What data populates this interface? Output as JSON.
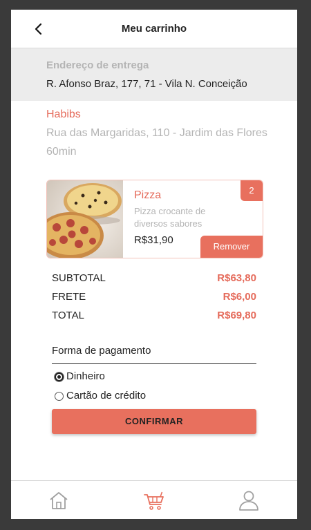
{
  "header": {
    "title": "Meu carrinho",
    "back_icon": "chevron-left-icon"
  },
  "delivery": {
    "label": "Endereço de entrega",
    "address": "R. Afonso Braz, 177, 71 - Vila N. Conceição"
  },
  "restaurant": {
    "name": "Habibs",
    "address": "Rua das Margaridas, 110 - Jardim das Flores",
    "time": "60min"
  },
  "cart_items": [
    {
      "name": "Pizza",
      "description": "Pizza crocante de diversos sabores",
      "price": "R$31,90",
      "quantity": "2",
      "remove_label": "Remover"
    }
  ],
  "totals": {
    "subtotal_label": "SUBTOTAL",
    "subtotal_value": "R$63,80",
    "frete_label": "FRETE",
    "frete_value": "R$6,00",
    "total_label": "TOTAL",
    "total_value": "R$69,80"
  },
  "payment": {
    "title": "Forma de pagamento",
    "options": [
      {
        "label": "Dinheiro",
        "selected": true
      },
      {
        "label": "Cartão de crédito",
        "selected": false
      }
    ],
    "confirm_label": "CONFIRMAR"
  },
  "bottom_nav": {
    "items": [
      {
        "icon": "home-icon",
        "active": false
      },
      {
        "icon": "cart-icon",
        "active": true
      },
      {
        "icon": "user-icon",
        "active": false
      }
    ]
  },
  "colors": {
    "accent": "#e8705e",
    "accent_text": "#e56b5b",
    "muted_text": "#b4b4b4",
    "nav_inactive": "#a0a0a0"
  }
}
